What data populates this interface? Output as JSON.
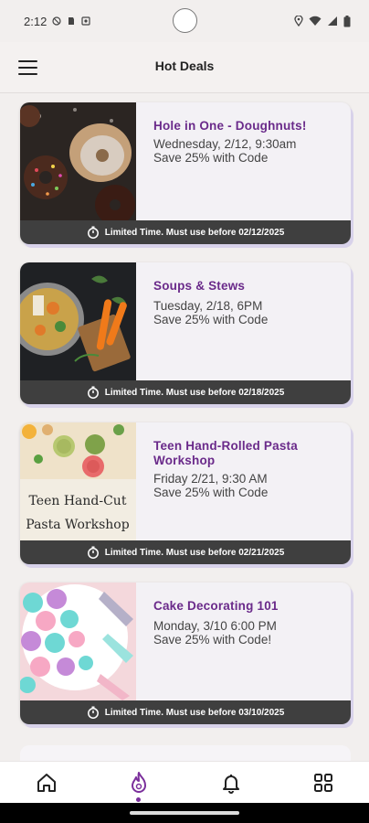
{
  "status_bar": {
    "time": "2:12"
  },
  "header": {
    "title": "Hot Deals"
  },
  "deals": [
    {
      "title": "Hole in One - Doughnuts!",
      "line1": "Wednesday, 2/12, 9:30am",
      "line2": "Save 25% with Code",
      "footer": "Limited Time. Must use before 02/12/2025"
    },
    {
      "title": "Soups & Stews",
      "line1": "Tuesday, 2/18, 6PM",
      "line2": "Save 25% with Code",
      "footer": "Limited Time. Must use before 02/18/2025"
    },
    {
      "title": "Teen Hand-Rolled Pasta Workshop",
      "line1": "Friday 2/21, 9:30 AM",
      "line2": "Save 25% with Code",
      "footer": "Limited Time. Must use before 02/21/2025",
      "image_text": [
        "Teen Hand-Cut",
        "Pasta Workshop"
      ]
    },
    {
      "title": "Cake Decorating 101",
      "line1": "Monday, 3/10 6:00 PM",
      "line2": "Save 25% with Code!",
      "footer": "Limited Time. Must use before 03/10/2025"
    }
  ],
  "nav": {
    "items": [
      "home-icon",
      "flame-icon",
      "bell-icon",
      "grid-icon"
    ],
    "active": "flame-icon",
    "accent": "#7b2f9c"
  },
  "colors": {
    "title": "#6a2a8a",
    "footer_bg": "#3f3f3f",
    "card_shadow": "#d8d2ea"
  }
}
